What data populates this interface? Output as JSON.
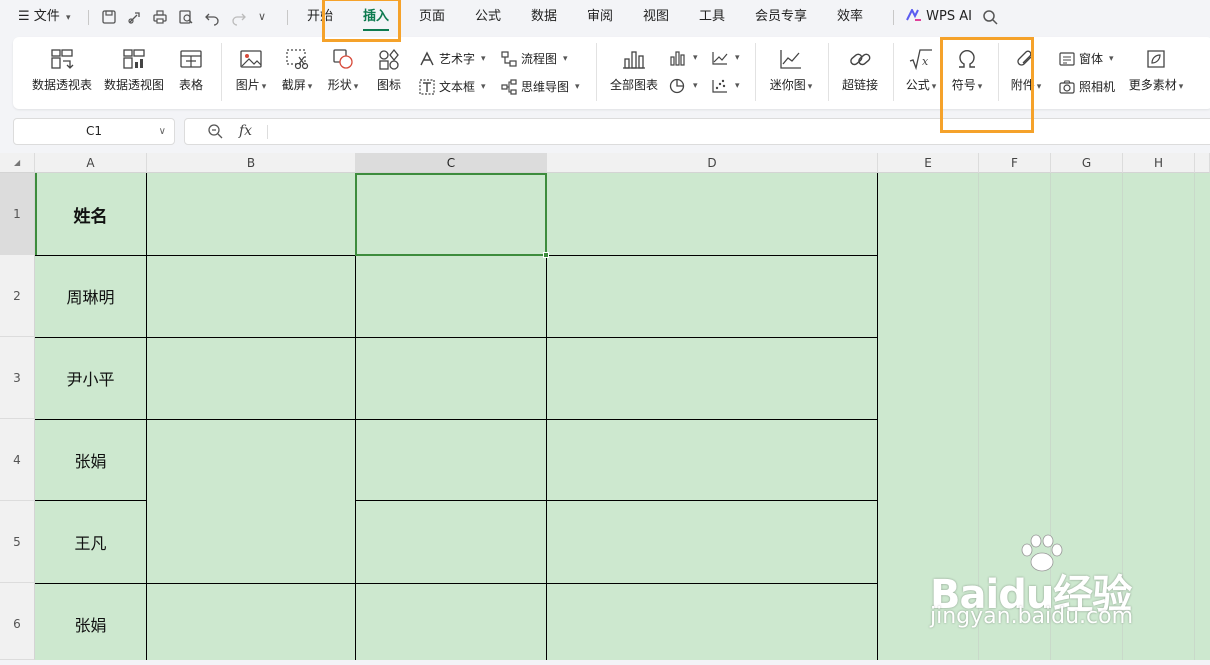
{
  "menu": {
    "file_label": "文件",
    "tabs": [
      {
        "label": "开始",
        "active": false
      },
      {
        "label": "插入",
        "active": true
      },
      {
        "label": "页面",
        "active": false
      },
      {
        "label": "公式",
        "active": false
      },
      {
        "label": "数据",
        "active": false
      },
      {
        "label": "审阅",
        "active": false
      },
      {
        "label": "视图",
        "active": false
      },
      {
        "label": "工具",
        "active": false
      },
      {
        "label": "会员专享",
        "active": false
      },
      {
        "label": "效率",
        "active": false
      }
    ],
    "wps_ai_label": "WPS AI"
  },
  "ribbon": {
    "pivot_table": "数据透视表",
    "pivot_chart": "数据透视图",
    "table": "表格",
    "picture": "图片",
    "screenshot": "截屏",
    "shape": "形状",
    "icon": "图标",
    "art_text": "艺术字",
    "flowchart": "流程图",
    "textbox": "文本框",
    "mindmap": "思维导图",
    "all_charts": "全部图表",
    "sparkline": "迷你图",
    "hyperlink": "超链接",
    "formula": "公式",
    "symbol": "符号",
    "attachment": "附件",
    "window": "窗体",
    "camera": "照相机",
    "more_materials": "更多素材"
  },
  "formula_bar": {
    "name_box": "C1",
    "fx_label": "fx",
    "content": ""
  },
  "sheet": {
    "columns": [
      "A",
      "B",
      "C",
      "D",
      "E",
      "F",
      "G",
      "H"
    ],
    "selected_column": "C",
    "rows": [
      "1",
      "2",
      "3",
      "4",
      "5",
      "6"
    ],
    "selected_cell": "C1",
    "cells": {
      "A1": "姓名",
      "A2": "周琳明",
      "A3": "尹小平",
      "A4": "张娟",
      "A5": "王凡",
      "A6": "张娟"
    },
    "fill_color": "#cde8cf"
  },
  "highlight_color": "#f5a22a",
  "accent_color": "#0e7a4f",
  "watermark": {
    "main": "Baidu经验",
    "sub": "jingyan.baidu.com"
  }
}
